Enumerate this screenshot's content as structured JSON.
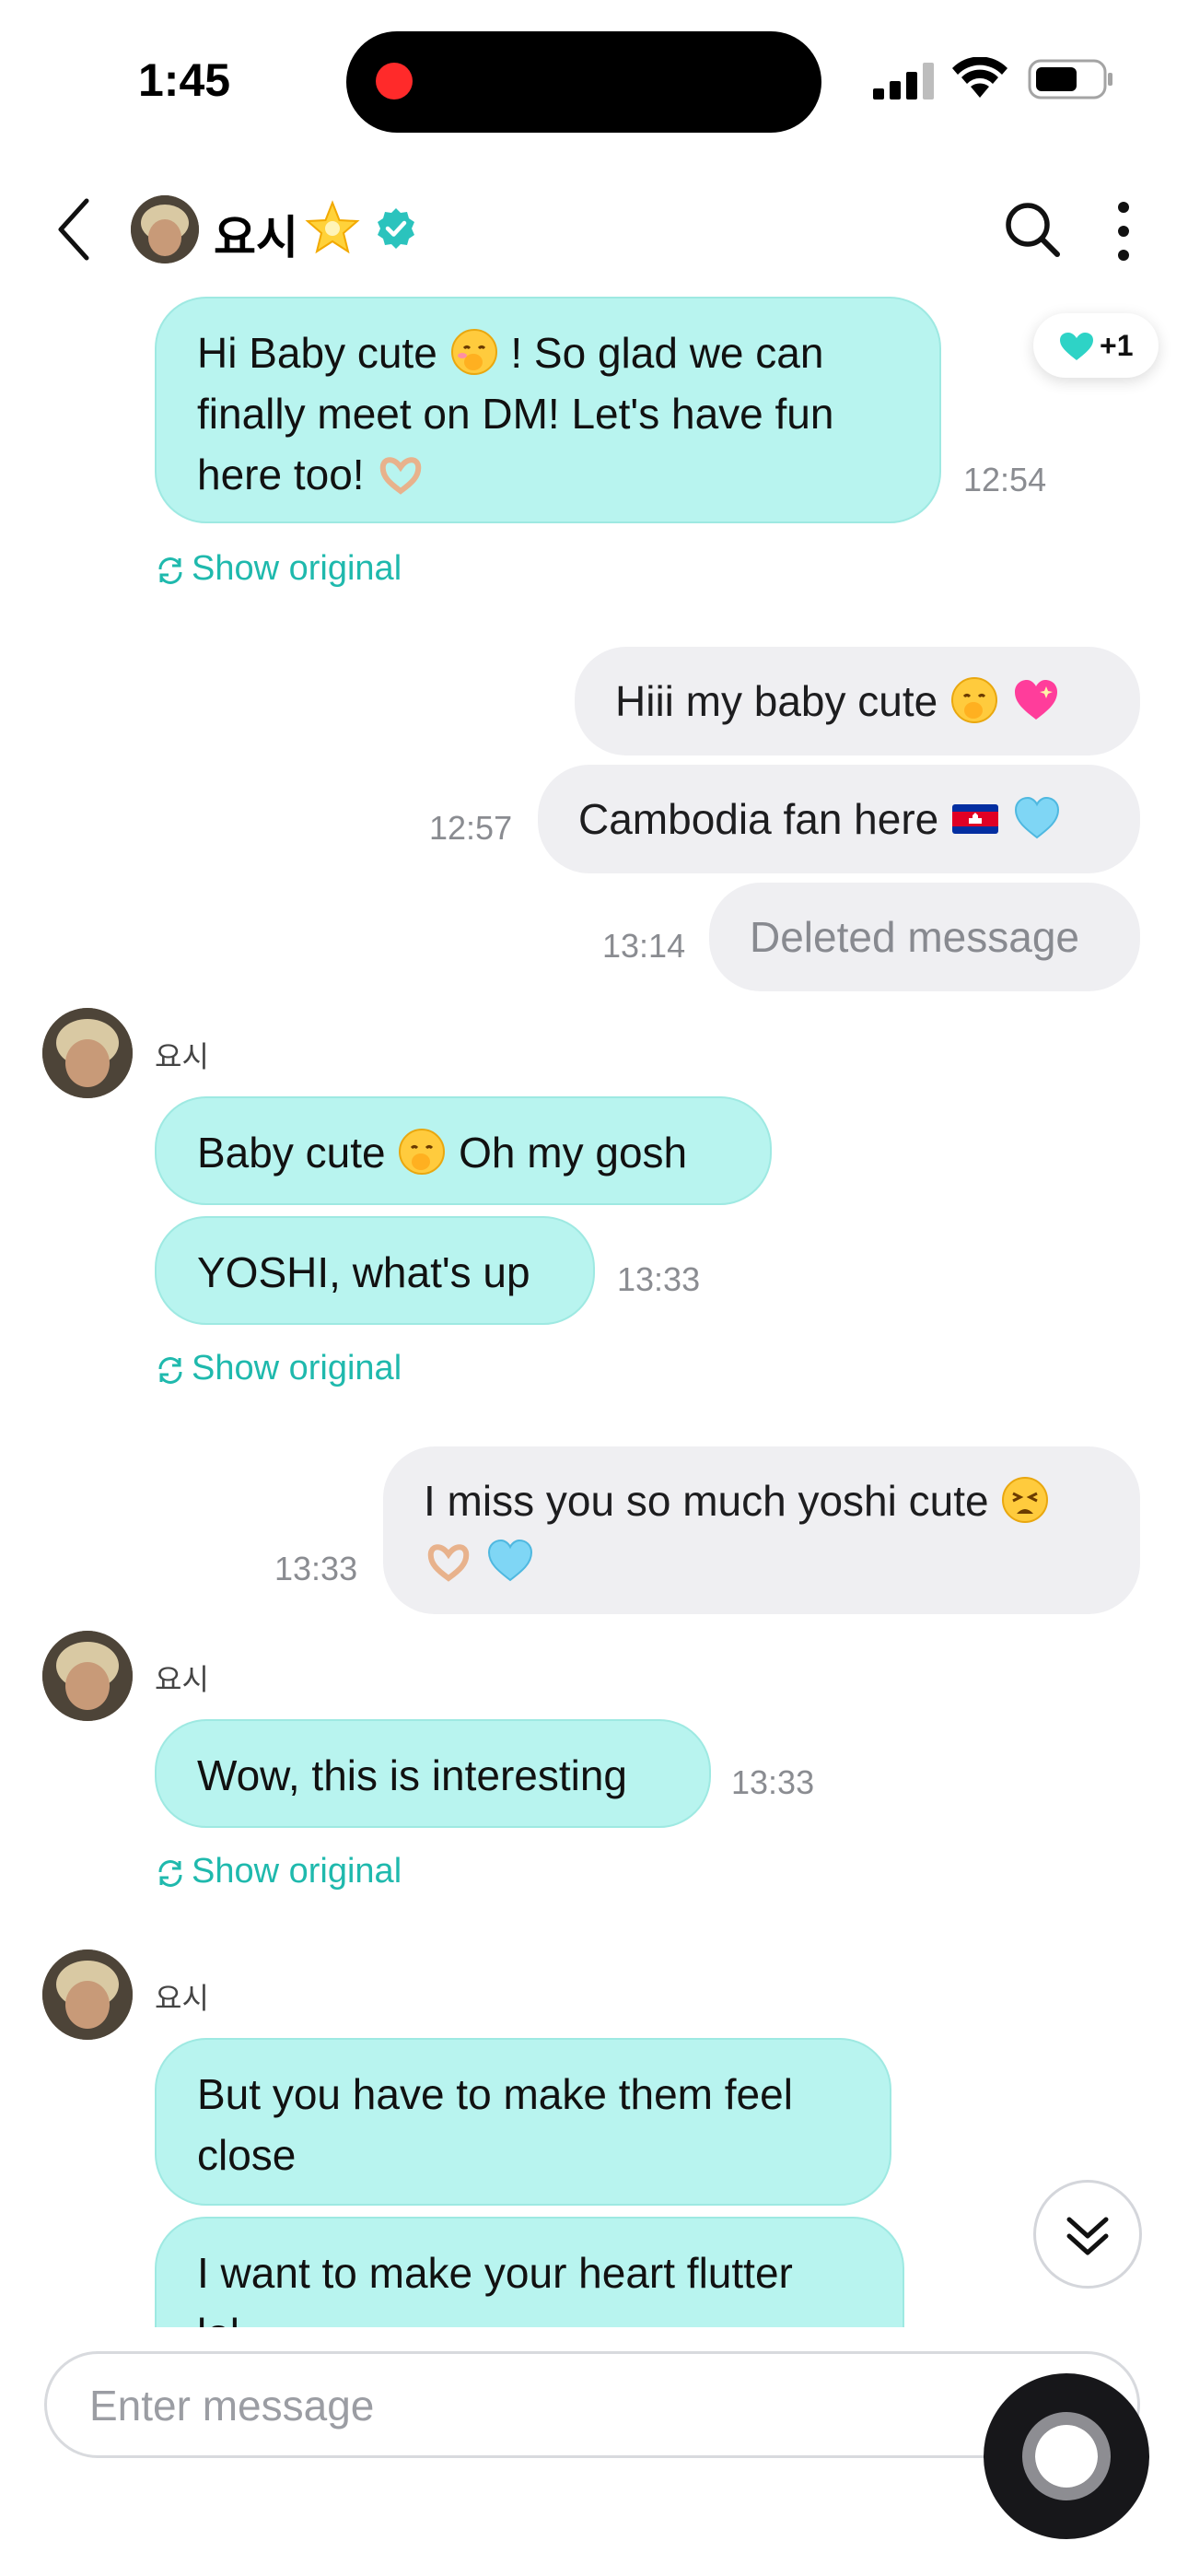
{
  "status_bar": {
    "time": "1:45"
  },
  "header": {
    "name": "요시"
  },
  "messages": {
    "m1": {
      "text": "Hi Baby cute",
      "text2": "! So glad we can",
      "line2": "finally meet on DM! Let's have fun",
      "line3": "here too!",
      "time": "12:54"
    },
    "reaction": {
      "count": "+1"
    },
    "show_original": "Show original",
    "m2": {
      "text": "Hiii my baby cute"
    },
    "m3": {
      "text": "Cambodia fan here",
      "time": "12:57"
    },
    "m4": {
      "text": "Deleted message",
      "time": "13:14"
    },
    "sender": "요시",
    "m5": {
      "text1": "Baby cute",
      "text2": "Oh my gosh"
    },
    "m6": {
      "text": "YOSHI, what's up",
      "time": "13:33"
    },
    "m7": {
      "line1": "I miss you so much yoshi cute",
      "time": "13:33"
    },
    "m8": {
      "text": "Wow, this is interesting",
      "time": "13:33"
    },
    "m9": {
      "line1": "But you have to make them feel",
      "line2": "close"
    },
    "m10": {
      "line1": "I want to make your heart flutter",
      "line2": "lol"
    }
  },
  "composer": {
    "placeholder": "Enter message"
  },
  "colors": {
    "incoming_bubble": "#b8f4ef",
    "outgoing_bubble": "#efeff2",
    "accent": "#1fb9ad"
  }
}
